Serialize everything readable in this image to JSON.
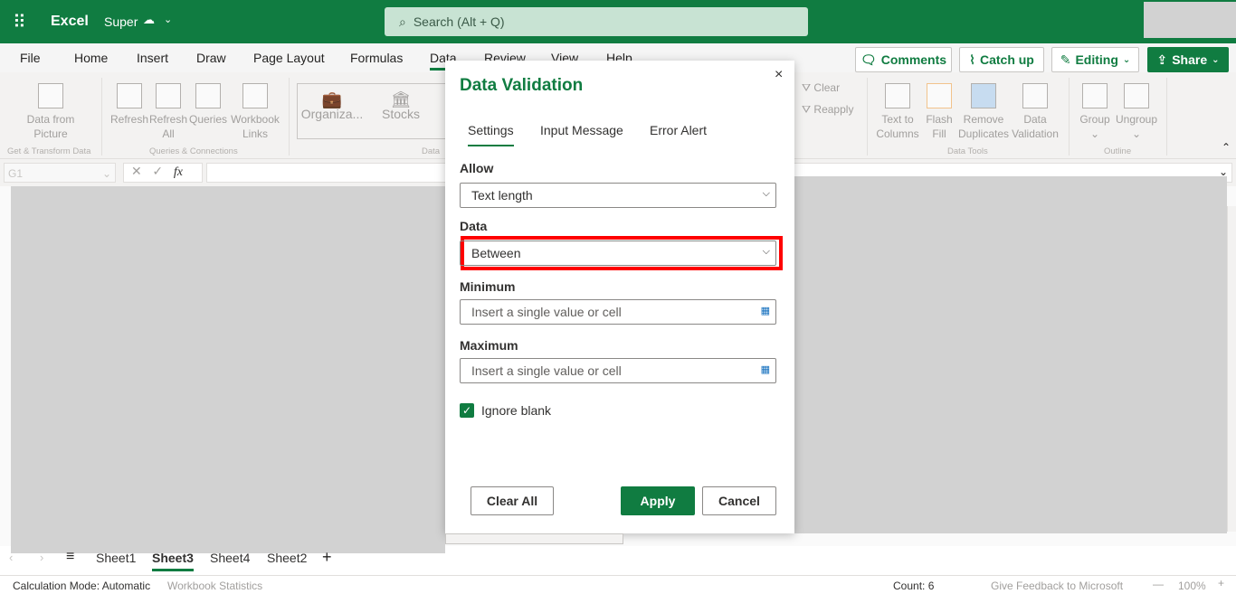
{
  "app": {
    "name": "Excel",
    "doc_name": "Super",
    "search_placeholder": "Search (Alt + Q)"
  },
  "menu_tabs": [
    "File",
    "Home",
    "Insert",
    "Draw",
    "Page Layout",
    "Formulas",
    "Data",
    "Review",
    "View",
    "Help"
  ],
  "active_tab": "Data",
  "actions": {
    "comments": "Comments",
    "catch_up": "Catch up",
    "editing": "Editing",
    "share": "Share"
  },
  "ribbon": {
    "data_from_picture": [
      "Data from",
      "Picture"
    ],
    "group_get": "Get & Transform Data",
    "refresh": "Refresh",
    "refresh_all": [
      "Refresh",
      "All"
    ],
    "queries": "Queries",
    "workbook_links": [
      "Workbook",
      "Links"
    ],
    "group_queries": "Queries & Connections",
    "organization": "Organiza...",
    "stocks": "Stocks",
    "group_data": "Data",
    "clear": "Clear",
    "reapply": "Reapply",
    "text_to_columns": [
      "Text to",
      "Columns"
    ],
    "flash_fill": [
      "Flash",
      "Fill"
    ],
    "remove_duplicates": [
      "Remove",
      "Duplicates"
    ],
    "data_validation": [
      "Data",
      "Validation"
    ],
    "group_tools": "Data Tools",
    "group": "Group",
    "ungroup": "Ungroup",
    "group_outline": "Outline"
  },
  "formula_bar": {
    "name_box": "G1",
    "fx": "fx",
    "value": ""
  },
  "dialog": {
    "title": "Data Validation",
    "tabs": [
      "Settings",
      "Input Message",
      "Error Alert"
    ],
    "active_tab": "Settings",
    "allow_label": "Allow",
    "allow_value": "Text length",
    "data_label": "Data",
    "data_value": "Between",
    "minimum_label": "Minimum",
    "minimum_placeholder": "Insert a single value or cell",
    "maximum_label": "Maximum",
    "maximum_placeholder": "Insert a single value or cell",
    "ignore_blank_label": "Ignore blank",
    "ignore_blank_checked": true,
    "clear_all": "Clear All",
    "apply": "Apply",
    "cancel": "Cancel",
    "close": "×",
    "highlight_color": "#ff0000"
  },
  "sheets": [
    "Sheet1",
    "Sheet3",
    "Sheet4",
    "Sheet2"
  ],
  "active_sheet": "Sheet3",
  "status": {
    "calc_mode": "Calculation Mode: Automatic",
    "workbook_stats": "Workbook Statistics",
    "count": "Count: 6",
    "feedback": "Give Feedback to Microsoft",
    "zoom": "100%"
  },
  "colors": {
    "brand": "#107c41"
  }
}
